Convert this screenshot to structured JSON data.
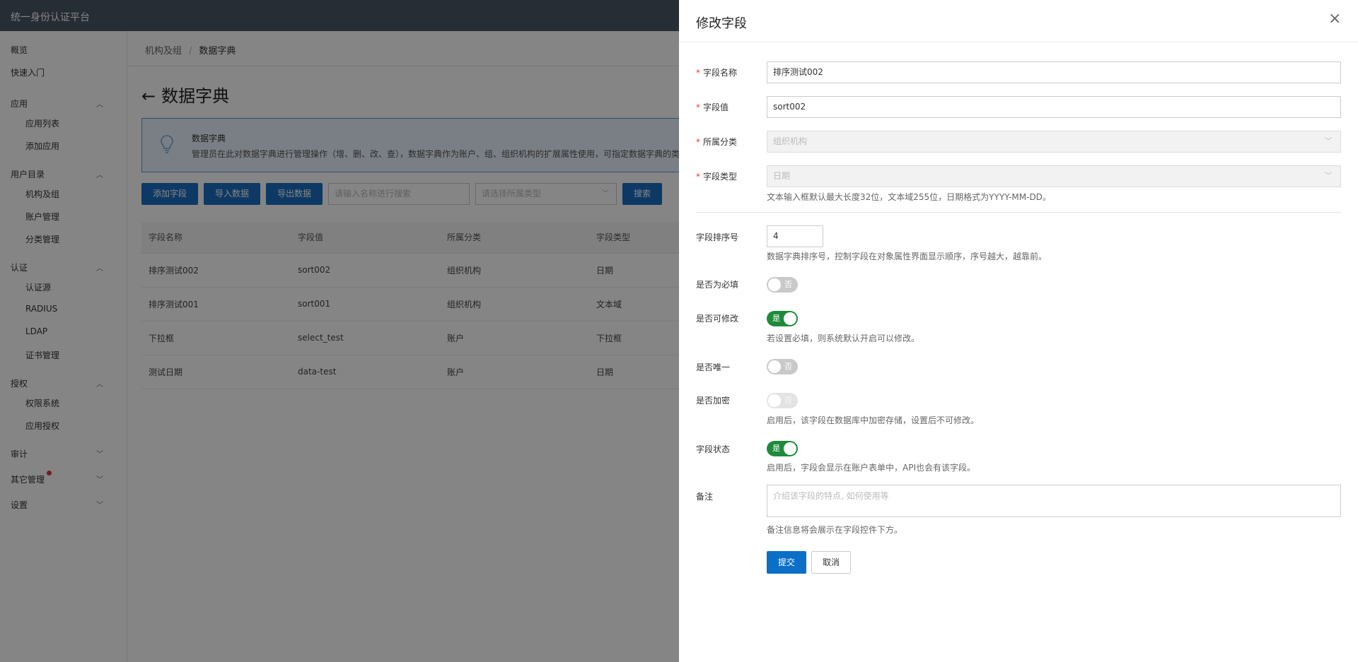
{
  "app_title": "统一身份认证平台",
  "sidebar": {
    "items": [
      {
        "label": "概览"
      },
      {
        "label": "快速入门"
      },
      {
        "label": "应用",
        "chevron": "up",
        "children": [
          "应用列表",
          "添加应用"
        ]
      },
      {
        "label": "用户目录",
        "chevron": "up",
        "children": [
          "机构及组",
          "账户管理",
          "分类管理"
        ]
      },
      {
        "label": "认证",
        "chevron": "up",
        "children": [
          "认证源",
          "RADIUS",
          "LDAP",
          "证书管理"
        ]
      },
      {
        "label": "授权",
        "chevron": "up",
        "children": [
          "权限系统",
          "应用授权"
        ]
      },
      {
        "label": "审计",
        "chevron": "down"
      },
      {
        "label": "其它管理",
        "chevron": "down",
        "badge_dot": true
      },
      {
        "label": "设置",
        "chevron": "down"
      }
    ]
  },
  "breadcrumb": [
    "机构及组",
    "数据字典"
  ],
  "page_title": "数据字典",
  "notice": {
    "title": "数据字典",
    "text": "管理员在此对数据字典进行管理操作（增、删、改、查），数据字典作为账户、组、组织机构的扩展属性使用，可指定数据字典的类"
  },
  "toolbar": {
    "add_label": "添加字段",
    "import_label": "导入数据",
    "export_label": "导出数据",
    "search_placeholder": "请输入名称进行搜索",
    "category_placeholder": "请选择所属类型",
    "search_label": "搜索"
  },
  "table": {
    "columns": [
      "字段名称",
      "字段值",
      "所属分类",
      "字段类型"
    ],
    "rows": [
      [
        "排序测试002",
        "sort002",
        "组织机构",
        "日期"
      ],
      [
        "排序测试001",
        "sort001",
        "组织机构",
        "文本域"
      ],
      [
        "下拉框",
        "select_test",
        "账户",
        "下拉框"
      ],
      [
        "测试日期",
        "data-test",
        "账户",
        "日期"
      ]
    ]
  },
  "drawer": {
    "title": "修改字段",
    "close_icon": "close-icon",
    "fields": {
      "name": {
        "label": "字段名称",
        "value": "排序测试002",
        "required": true
      },
      "value": {
        "label": "字段值",
        "value": "sort002",
        "required": true
      },
      "category": {
        "label": "所属分类",
        "value": "组织机构",
        "required": true,
        "disabled": true
      },
      "type": {
        "label": "字段类型",
        "value": "日期",
        "required": true,
        "disabled": true,
        "hint": "文本输入框默认最大长度32位，文本域255位，日期格式为YYYY-MM-DD。"
      },
      "sort": {
        "label": "字段排序号",
        "value": "4",
        "hint": "数据字典排序号，控制字段在对象属性界面显示顺序，序号越大，越靠前。"
      },
      "required_switch": {
        "label": "是否为必填",
        "state": "否",
        "on": false
      },
      "editable_switch": {
        "label": "是否可修改",
        "state": "是",
        "on": true,
        "hint": "若设置必填，则系统默认开启可以修改。"
      },
      "unique_switch": {
        "label": "是否唯一",
        "state": "否",
        "on": false
      },
      "encrypt_switch": {
        "label": "是否加密",
        "state": "否",
        "on": false,
        "disabled": true,
        "hint": "启用后，该字段在数据库中加密存储，设置后不可修改。"
      },
      "status_switch": {
        "label": "字段状态",
        "state": "是",
        "on": true,
        "hint": "启用后，字段会显示在账户表单中，API也会有该字段。"
      },
      "remark": {
        "label": "备注",
        "placeholder": "介绍该字段的特点, 如何使用等",
        "hint": "备注信息将会展示在字段控件下方。"
      }
    },
    "submit_label": "提交",
    "cancel_label": "取消"
  },
  "colors": {
    "topbar": "#4a5666",
    "primary_button": "#1b6ec2",
    "switch_on": "#1f8b3a",
    "required_star": "#e4393c",
    "notice_border": "#5b9bd5"
  }
}
